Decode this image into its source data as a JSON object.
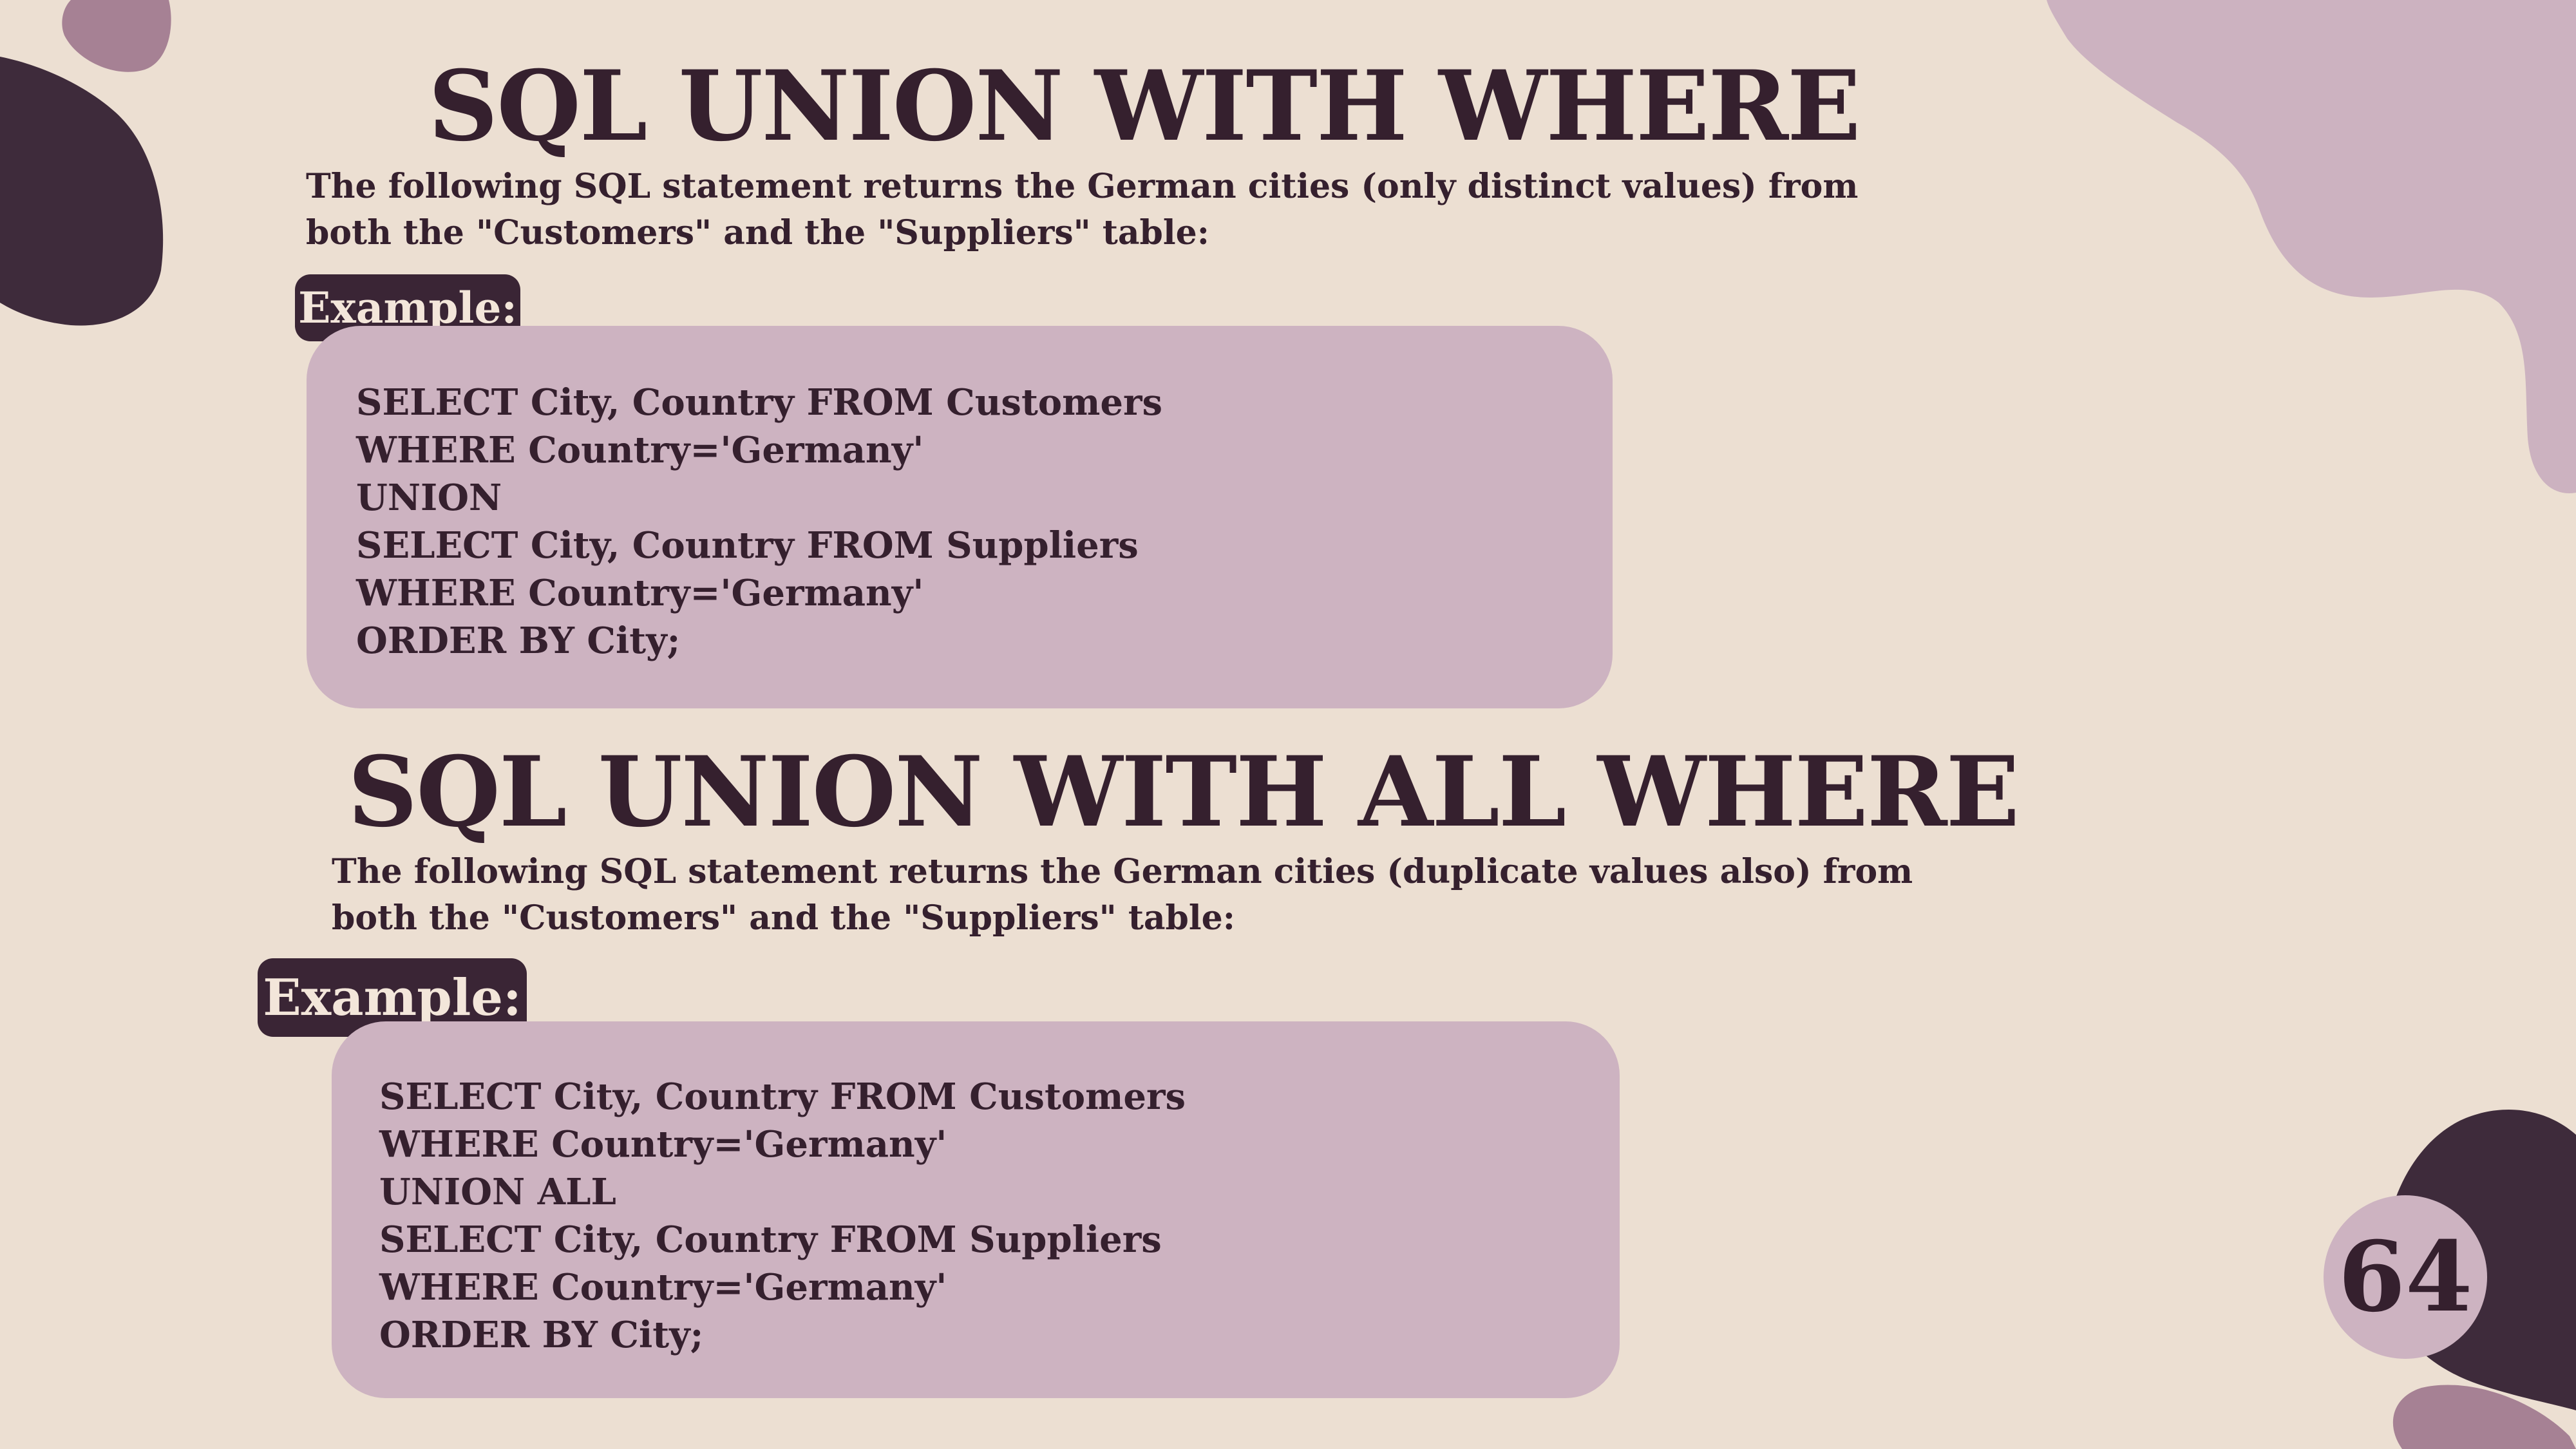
{
  "colors": {
    "background": "#ecdfd2",
    "text_dark": "#35202e",
    "code_box": "#cdb3c1",
    "pill_bg": "#3a2535",
    "pill_text": "#f3e6da",
    "blob_light": "#ccb2c0",
    "blob_mauve": "#a68194",
    "blob_dark": "#3e2b3b"
  },
  "section1": {
    "title": "SQL UNION WITH WHERE",
    "description": "The following SQL statement returns the German cities (only distinct values) from both the \"Customers\" and the \"Suppliers\" table:",
    "example_label": "Example:",
    "code_lines": [
      "SELECT City, Country FROM Customers",
      "WHERE Country='Germany'",
      "UNION",
      "SELECT City, Country FROM Suppliers",
      "WHERE Country='Germany'",
      "ORDER BY City;"
    ]
  },
  "section2": {
    "title": "SQL UNION WITH ALL WHERE",
    "description": "The following SQL statement returns the German cities (duplicate values also) from both the \"Customers\" and the \"Suppliers\" table:",
    "example_label": "Example:",
    "code_lines": [
      "SELECT City, Country FROM Customers",
      "WHERE Country='Germany'",
      "UNION ALL",
      "SELECT City, Country FROM Suppliers",
      "WHERE Country='Germany'",
      "ORDER BY City;"
    ]
  },
  "page_number": "64"
}
